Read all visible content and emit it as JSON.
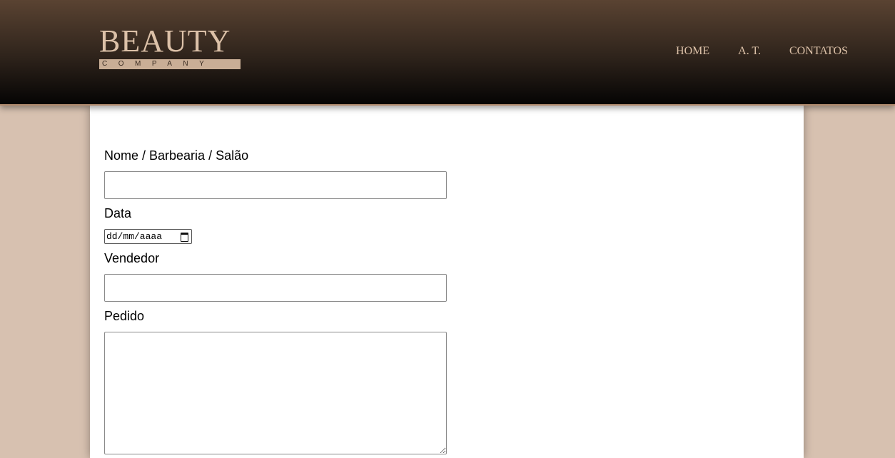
{
  "brand": {
    "name": "BEAUTY",
    "subtitle": "COMPANY"
  },
  "nav": {
    "items": [
      "HOME",
      "A. T.",
      "CONTATOS"
    ]
  },
  "form": {
    "name_label": "Nome / Barbearia / Salão",
    "name_value": "",
    "date_label": "Data",
    "date_placeholder": "dd/mm/aaaa",
    "seller_label": "Vendedor",
    "seller_value": "",
    "order_label": "Pedido",
    "order_value": ""
  },
  "colors": {
    "header_top": "#5a4332",
    "header_bottom": "#050404",
    "accent_text": "#dcc1a8",
    "background": "#d7c1b0",
    "panel": "#ffffff"
  },
  "icons": {
    "date_picker": "calendar-icon"
  }
}
